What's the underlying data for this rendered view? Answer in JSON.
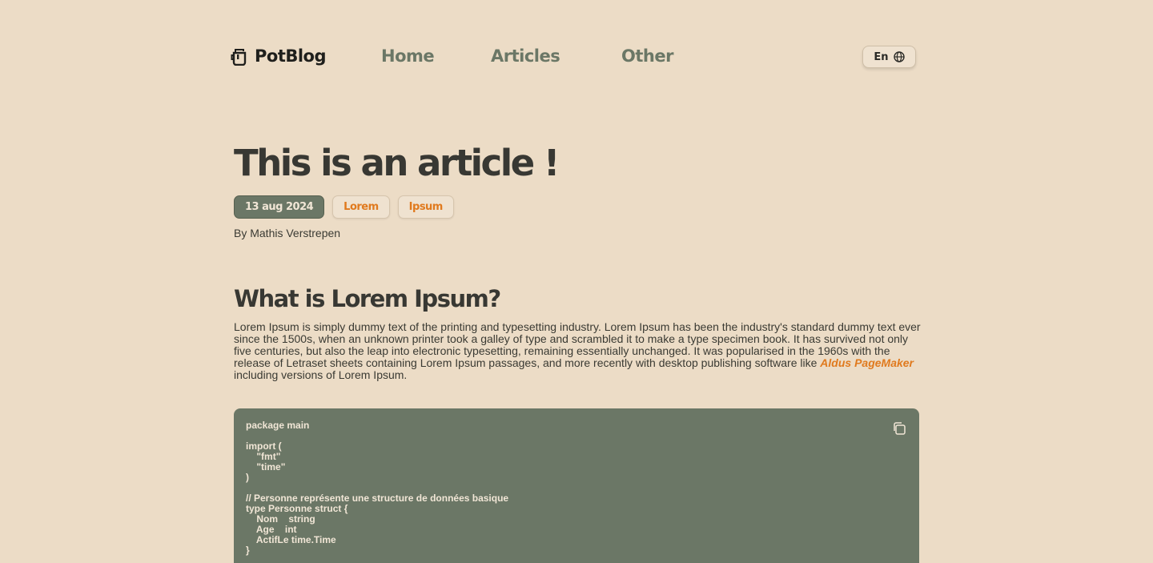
{
  "nav": {
    "brand": "PotBlog",
    "brand_icon": "pot-icon",
    "links": [
      "Home",
      "Articles",
      "Other"
    ],
    "language": "En",
    "language_icon": "globe-icon"
  },
  "article": {
    "title": "This is an article !",
    "date": "13 aug 2024",
    "tags": [
      "Lorem",
      "Ipsum"
    ],
    "author": "By Mathis Verstrepen",
    "section_title": "What is Lorem Ipsum?",
    "paragraph_before_link": "Lorem Ipsum is simply dummy text of the printing and  typesetting industry. Lorem Ipsum has been the industry's standard dummy text ever since the 1500s, when an unknown printer took a galley of  type and scrambled it to make a type specimen book. It has survived not  only five centuries, but also the leap into electronic typesetting,  remaining essentially unchanged. It was popularised in the 1960s with  the release of Letraset sheets containing Lorem Ipsum passages, and more recently with desktop publishing software like ",
    "paragraph_link": "Aldus PageMaker",
    "paragraph_after_link": "  including versions of Lorem Ipsum.",
    "code": "package main\n\nimport (\n    \"fmt\"\n    \"time\"\n)\n\n// Personne représente une structure de données basique\ntype Personne struct {\n    Nom    string\n    Age    int\n    ActifLe time.Time\n}",
    "copy_icon": "copy-icon"
  },
  "colors": {
    "background": "#ecdcc6",
    "accent_green": "#6b7766",
    "accent_orange": "#e07a1e",
    "text_dark": "#383833"
  }
}
